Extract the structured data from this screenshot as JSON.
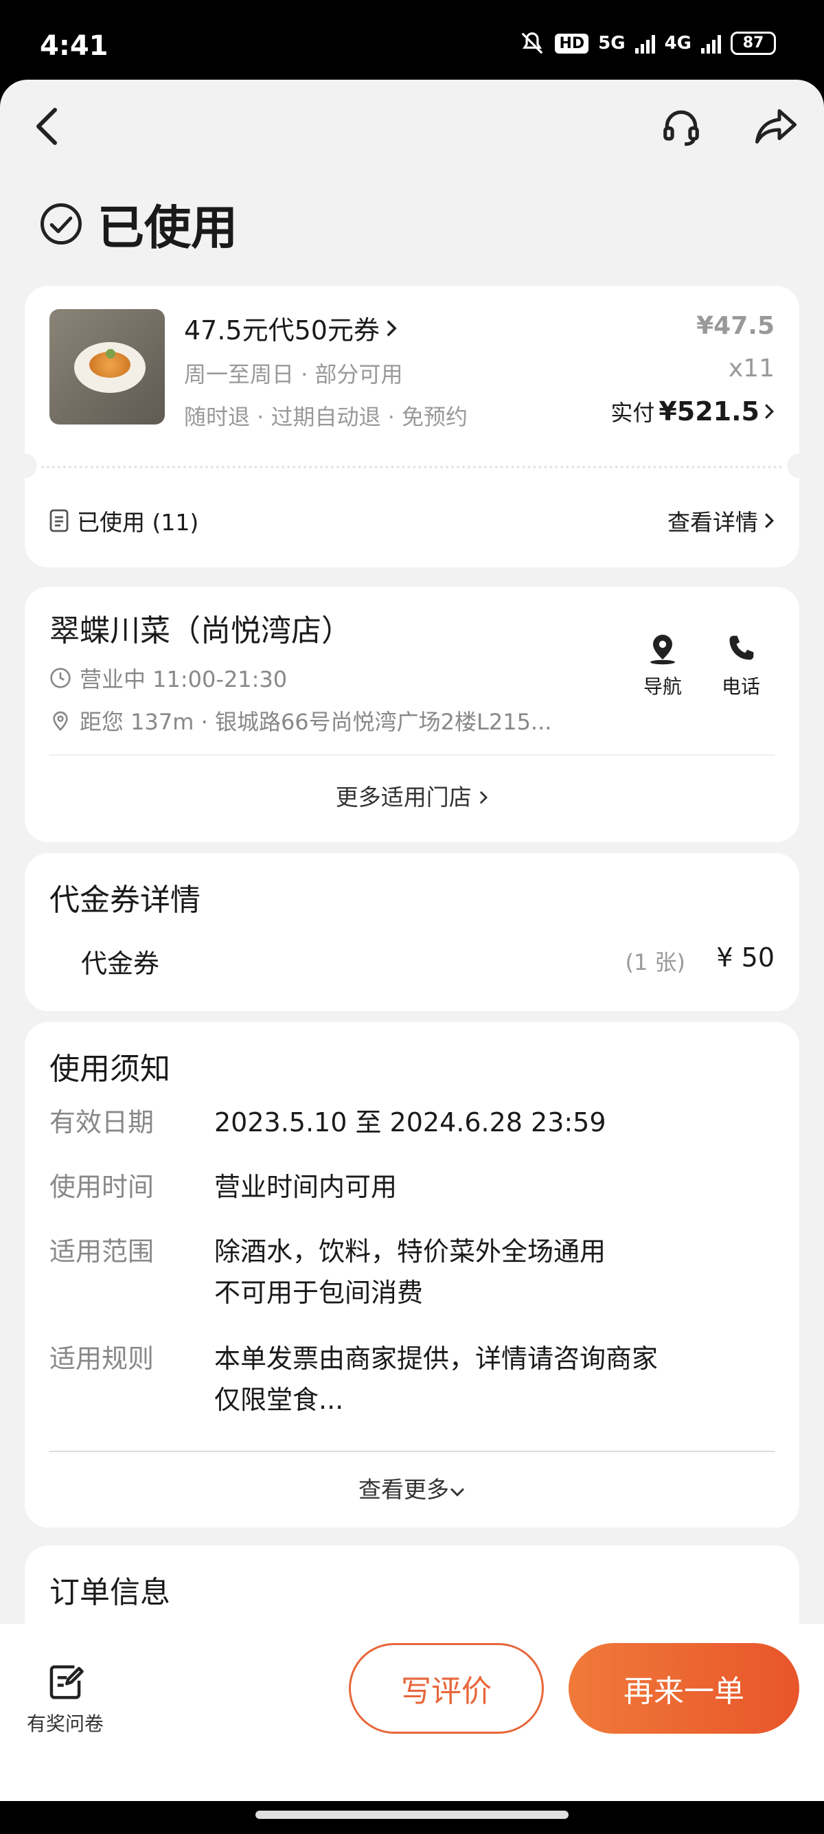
{
  "statusbar": {
    "time": "4:41",
    "hd": "HD",
    "net1": "5G",
    "net2": "4G",
    "battery": "87"
  },
  "order": {
    "status": "已使用",
    "product": {
      "title": "47.5元代50元券",
      "availability": "周一至周日 · 部分可用",
      "policy": "随时退 · 过期自动退 · 免预约",
      "unit_price": "¥47.5",
      "quantity": "x11",
      "paid_label": "实付",
      "paid_amount": "¥521.5"
    },
    "usage": {
      "label": "已使用 (11)",
      "detail_link": "查看详情"
    }
  },
  "store": {
    "name": "翠蝶川菜（尚悦湾店）",
    "hours": "营业中 11:00-21:30",
    "address": "距您 137m ·  银城路66号尚悦湾广场2楼L215...",
    "nav_label": "导航",
    "phone_label": "电话",
    "more_stores": "更多适用门店"
  },
  "voucher": {
    "heading": "代金券详情",
    "item_name": "代金券",
    "count": "(1 张)",
    "amount": "¥ 50"
  },
  "notice": {
    "heading": "使用须知",
    "rows": [
      {
        "key": "有效日期",
        "lines": [
          "2023.5.10 至 2024.6.28 23:59"
        ]
      },
      {
        "key": "使用时间",
        "lines": [
          "营业时间内可用"
        ]
      },
      {
        "key": "适用范围",
        "lines": [
          "除酒水，饮料，特价菜外全场通用",
          "不可用于包间消费"
        ]
      },
      {
        "key": "适用规则",
        "lines": [
          "本单发票由商家提供，详情请咨询商家",
          "仅限堂食..."
        ]
      }
    ],
    "more": "查看更多"
  },
  "order_info": {
    "heading": "订单信息"
  },
  "bottom": {
    "survey": "有奖问卷",
    "review": "写评价",
    "reorder": "再来一单"
  },
  "colors": {
    "accent": "#e8663a",
    "background": "#f2f2f2"
  }
}
